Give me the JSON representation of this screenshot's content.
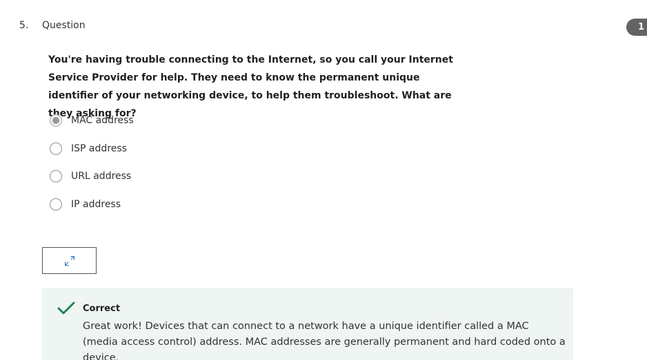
{
  "question": {
    "number": "5.",
    "label": "Question",
    "points_badge": "1",
    "prompt": "You're having trouble connecting to the Internet, so you call your Internet Service Provider for help. They need to know the permanent unique identifier of your networking device, to help them troubleshoot. What are they asking for?"
  },
  "options": [
    {
      "label": "MAC address",
      "selected": true
    },
    {
      "label": "ISP address",
      "selected": false
    },
    {
      "label": "URL address",
      "selected": false
    },
    {
      "label": "IP address",
      "selected": false
    }
  ],
  "expand_button": {
    "icon": "expand-icon"
  },
  "feedback": {
    "icon": "checkmark-icon",
    "title": "Correct",
    "text": "Great work! Devices that can connect to a network have a unique identifier called a MAC (media access control) address. MAC addresses are generally permanent and hard coded onto a device.",
    "accent_color": "#1f8354",
    "background_color": "#eff5f2"
  }
}
